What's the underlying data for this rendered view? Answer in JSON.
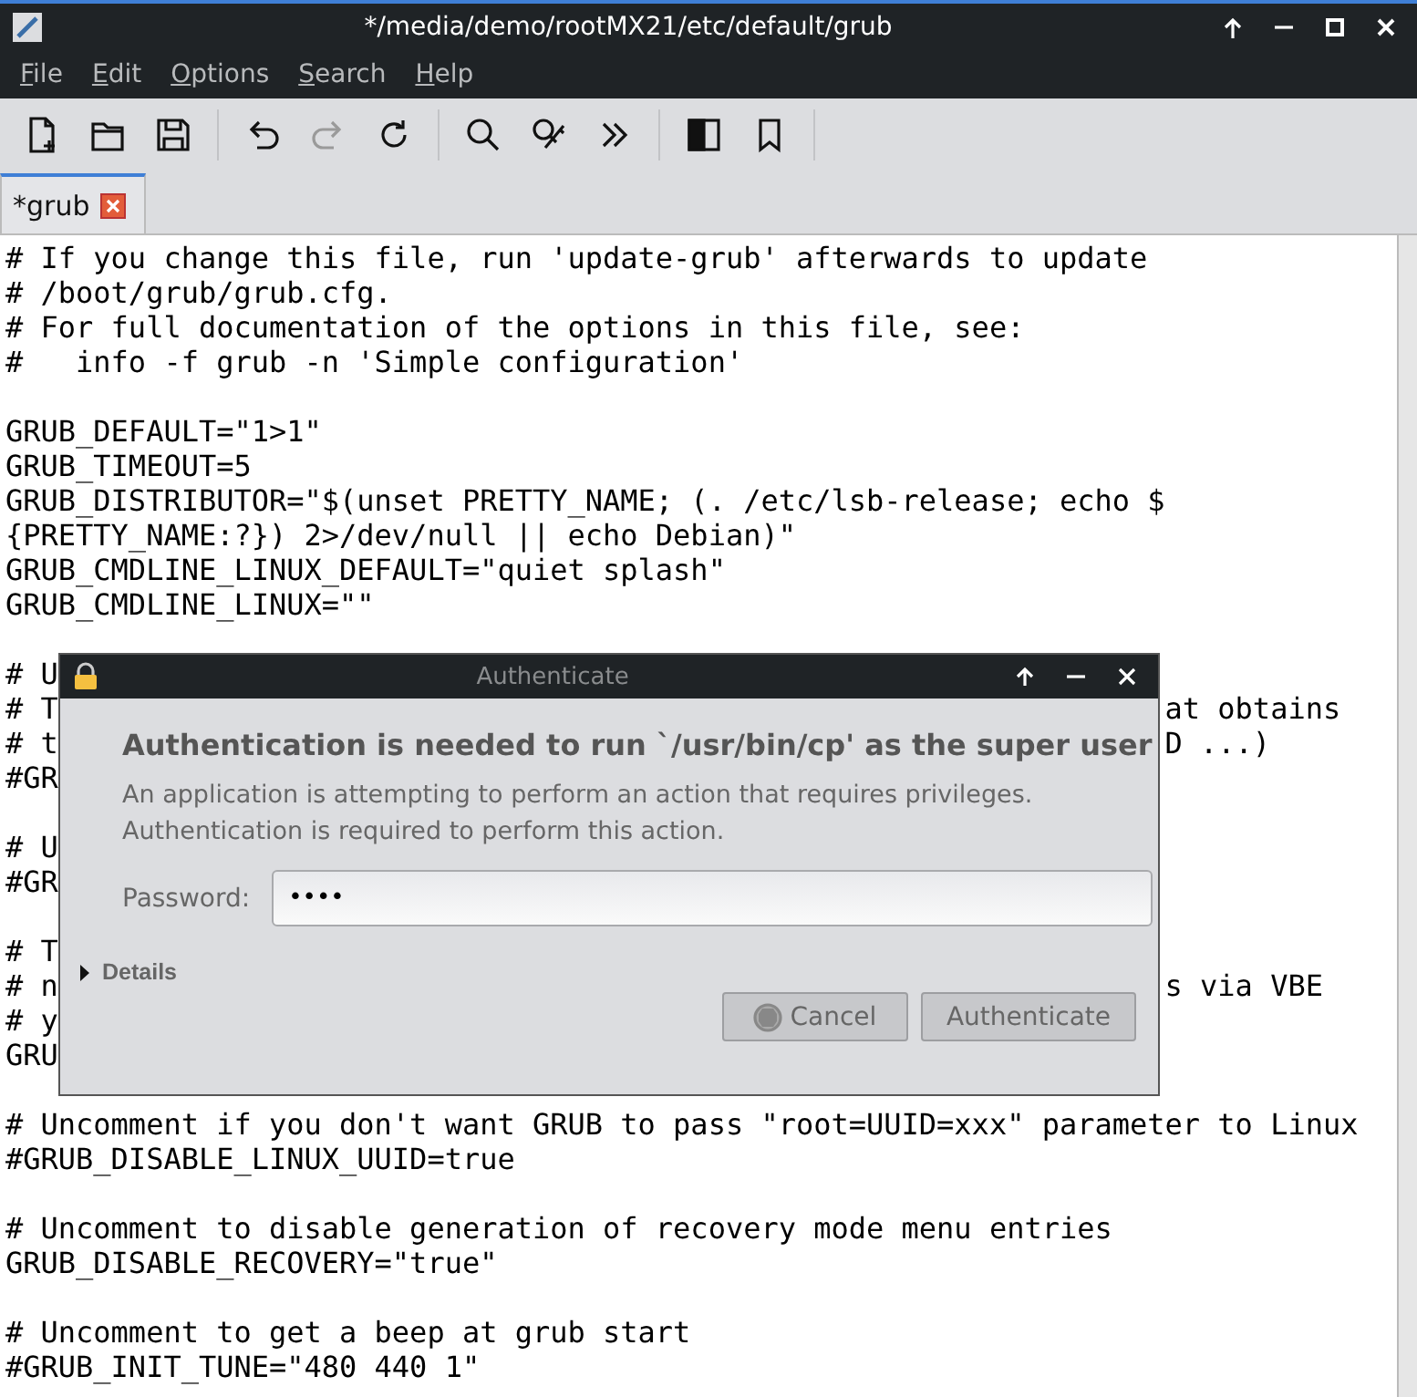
{
  "window": {
    "title": "*/media/demo/rootMX21/etc/default/grub"
  },
  "menu": [
    "File",
    "Edit",
    "Options",
    "Search",
    "Help"
  ],
  "toolbar": [
    {
      "kind": "new-file",
      "disabled": false
    },
    {
      "kind": "open",
      "disabled": false
    },
    {
      "kind": "save",
      "disabled": false
    },
    {
      "kind": "sep"
    },
    {
      "kind": "undo",
      "disabled": false
    },
    {
      "kind": "redo",
      "disabled": true
    },
    {
      "kind": "reload",
      "disabled": false
    },
    {
      "kind": "sep"
    },
    {
      "kind": "search",
      "disabled": false
    },
    {
      "kind": "replace",
      "disabled": false
    },
    {
      "kind": "more",
      "disabled": false
    },
    {
      "kind": "sep"
    },
    {
      "kind": "side-pane",
      "disabled": false
    },
    {
      "kind": "bookmark",
      "disabled": false
    },
    {
      "kind": "sep"
    }
  ],
  "tabs": [
    {
      "label": "*grub",
      "selected": true
    }
  ],
  "editor": {
    "lines": [
      {
        "kind": "text",
        "text": "# If you change this file, run 'update-grub' afterwards to update"
      },
      {
        "kind": "text",
        "text": "# /boot/grub/grub.cfg."
      },
      {
        "kind": "text",
        "text": "# For full documentation of the options in this file, see:"
      },
      {
        "kind": "text",
        "text": "#   info -f grub -n 'Simple configuration'"
      },
      {
        "kind": "blank"
      },
      {
        "kind": "text",
        "text": "GRUB_DEFAULT=\"1>1\""
      },
      {
        "kind": "text",
        "text": "GRUB_TIMEOUT=5"
      },
      {
        "kind": "text",
        "text": "GRUB_DISTRIBUTOR=\"$(unset PRETTY_NAME; (. /etc/lsb-release; echo $"
      },
      {
        "kind": "text",
        "text": "{PRETTY_NAME:?}) 2>/dev/null || echo Debian)\""
      },
      {
        "kind": "text",
        "text": "GRUB_CMDLINE_LINUX_DEFAULT=\"quiet splash\""
      },
      {
        "kind": "text",
        "text": "GRUB_CMDLINE_LINUX=\"\""
      },
      {
        "kind": "blank"
      },
      {
        "kind": "split",
        "left": "# U"
      },
      {
        "kind": "split",
        "left": "# T",
        "right": "at obtains"
      },
      {
        "kind": "split",
        "left": "# t",
        "right": "D ...)"
      },
      {
        "kind": "split",
        "left": "#GR"
      },
      {
        "kind": "blank"
      },
      {
        "kind": "split",
        "left": "# U"
      },
      {
        "kind": "split",
        "left": "#GR"
      },
      {
        "kind": "blank"
      },
      {
        "kind": "split",
        "left": "# T"
      },
      {
        "kind": "split",
        "left": "# n",
        "right": "s via VBE"
      },
      {
        "kind": "split",
        "left": "# y"
      },
      {
        "kind": "split",
        "left": "GRU"
      },
      {
        "kind": "blank"
      },
      {
        "kind": "text",
        "text": "# Uncomment if you don't want GRUB to pass \"root=UUID=xxx\" parameter to Linux"
      },
      {
        "kind": "text",
        "text": "#GRUB_DISABLE_LINUX_UUID=true"
      },
      {
        "kind": "blank"
      },
      {
        "kind": "text",
        "text": "# Uncomment to disable generation of recovery mode menu entries"
      },
      {
        "kind": "text",
        "text": "GRUB_DISABLE_RECOVERY=\"true\""
      },
      {
        "kind": "blank"
      },
      {
        "kind": "text",
        "text": "# Uncomment to get a beep at grub start"
      },
      {
        "kind": "text",
        "text": "#GRUB_INIT_TUNE=\"480 440 1\""
      }
    ]
  },
  "dialog": {
    "title": "Authenticate",
    "heading": "Authentication is needed to run `/usr/bin/cp' as the super user",
    "message": [
      "An application is attempting to perform an action that requires privileges.",
      "Authentication is required to perform this action."
    ],
    "password": {
      "label": "Password:",
      "value": "••••"
    },
    "details": {
      "label": "Details",
      "expanded": false
    },
    "buttons": [
      {
        "kind": "cancel",
        "label": "Cancel"
      },
      {
        "kind": "ok",
        "label": "Authenticate"
      }
    ]
  }
}
